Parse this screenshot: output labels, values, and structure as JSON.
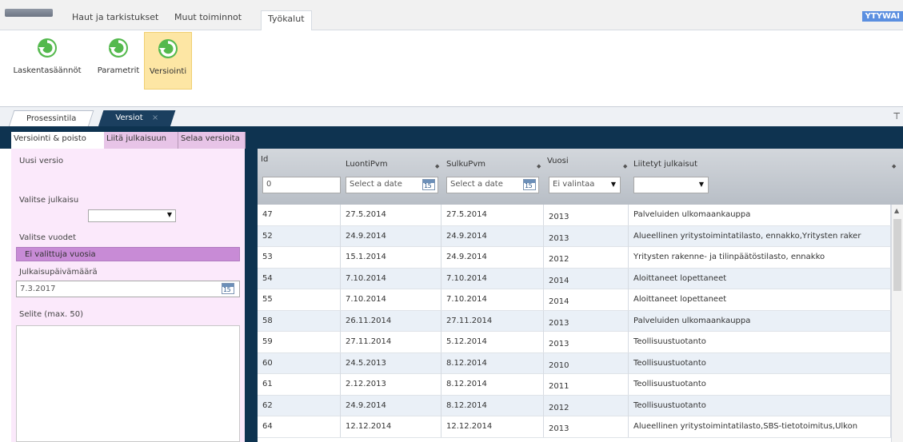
{
  "ribbon": {
    "tabs": [
      "Haut ja tarkistukset",
      "Muut toiminnot",
      "Työkalut"
    ],
    "user": "YTYWAI",
    "buttons": [
      "Laskentasäännöt",
      "Parametrit",
      "Versiointi"
    ]
  },
  "doc_tabs": {
    "inactive": "Prosessintila",
    "active": "Versiot",
    "close_glyph": "×",
    "pin_glyph": "⊤"
  },
  "sub_tabs": [
    "Versiointi & poisto",
    "Liitä julkaisuun",
    "Selaa versioita"
  ],
  "form": {
    "new_version": "Uusi versio",
    "select_publication": "Valitse julkaisu",
    "select_years": "Valitse vuodet",
    "no_years": "Ei valittuja vuosia",
    "publication_date_label": "Julkaisupäivämäärä",
    "publication_date": "7.3.2017",
    "notes_label": "Selite (max. 50)",
    "calendar_number": "15"
  },
  "grid": {
    "columns": [
      "Id",
      "LuontiPvm",
      "SulkuPvm",
      "Vuosi",
      "Liitetyt julkaisut"
    ],
    "filters": {
      "id": "0",
      "date_placeholder": "Select a date",
      "year": "Ei valintaa"
    },
    "rows": [
      [
        "47",
        "27.5.2014",
        "27.5.2014",
        "2013",
        "Palveluiden ulkomaankauppa"
      ],
      [
        "52",
        "24.9.2014",
        "24.9.2014",
        "2013",
        "Alueellinen yritystoimintatilasto, ennakko,Yritysten raker"
      ],
      [
        "53",
        "15.1.2014",
        "24.9.2014",
        "2012",
        "Yritysten rakenne- ja tilinpäätöstilasto, ennakko"
      ],
      [
        "54",
        "7.10.2014",
        "7.10.2014",
        "2014",
        "Aloittaneet lopettaneet"
      ],
      [
        "55",
        "7.10.2014",
        "7.10.2014",
        "2014",
        "Aloittaneet lopettaneet"
      ],
      [
        "58",
        "26.11.2014",
        "27.11.2014",
        "2013",
        "Palveluiden ulkomaankauppa"
      ],
      [
        "59",
        "27.11.2014",
        "5.12.2014",
        "2013",
        "Teollisuustuotanto"
      ],
      [
        "60",
        "24.5.2013",
        "8.12.2014",
        "2010",
        "Teollisuustuotanto"
      ],
      [
        "61",
        "2.12.2013",
        "8.12.2014",
        "2011",
        "Teollisuustuotanto"
      ],
      [
        "62",
        "24.9.2014",
        "8.12.2014",
        "2012",
        "Teollisuustuotanto"
      ],
      [
        "64",
        "12.12.2014",
        "12.12.2014",
        "2013",
        "Alueellinen yritystoimintatilasto,SBS-tietotoimitus,Ulkon"
      ]
    ]
  }
}
